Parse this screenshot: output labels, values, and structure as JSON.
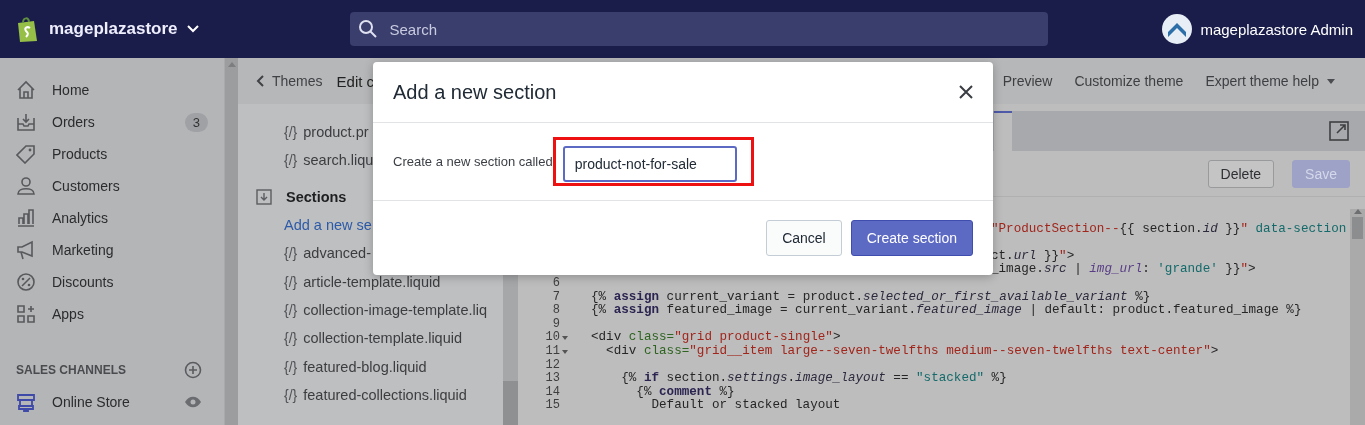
{
  "top_bar": {
    "store_name": "mageplazastore",
    "search": {
      "placeholder": "Search"
    },
    "account_name": "mageplazastore Admin"
  },
  "sidebar": {
    "items": [
      {
        "label": "Home"
      },
      {
        "label": "Orders",
        "badge": "3"
      },
      {
        "label": "Products"
      },
      {
        "label": "Customers"
      },
      {
        "label": "Analytics"
      },
      {
        "label": "Marketing"
      },
      {
        "label": "Discounts"
      },
      {
        "label": "Apps"
      }
    ],
    "sales_channels": {
      "heading": "SALES CHANNELS",
      "items": [
        {
          "label": "Online Store"
        }
      ]
    }
  },
  "header": {
    "back_link": "Themes",
    "title": "Edit c",
    "actions": [
      {
        "label": "Preview",
        "dropdown": false
      },
      {
        "label": "Customize theme",
        "dropdown": false
      },
      {
        "label": "Expert theme help",
        "dropdown": true
      }
    ]
  },
  "file_list": {
    "items": [
      {
        "kind": "file",
        "glyph": "{/}",
        "label": "product.pr"
      },
      {
        "kind": "file",
        "glyph": "{/}",
        "label": "search.liqu"
      },
      {
        "kind": "folder",
        "label": "Sections"
      },
      {
        "kind": "link",
        "label": "Add a new se"
      },
      {
        "kind": "file",
        "glyph": "{/}",
        "label": "advanced-"
      },
      {
        "kind": "file",
        "glyph": "{/}",
        "label": "article-template.liquid"
      },
      {
        "kind": "file",
        "glyph": "{/}",
        "label": "collection-image-template.liq"
      },
      {
        "kind": "file",
        "glyph": "{/}",
        "label": "collection-template.liquid"
      },
      {
        "kind": "file",
        "glyph": "{/}",
        "label": "featured-blog.liquid"
      },
      {
        "kind": "file",
        "glyph": "{/}",
        "label": "featured-collections.liquid"
      }
    ]
  },
  "editor": {
    "buttons": [
      {
        "label": "Delete",
        "disabled": false
      },
      {
        "label": "Save",
        "disabled": true
      }
    ],
    "lines": [
      {
        "kind": "hidden"
      },
      {
        "kind": "fragment",
        "tokens": [
          {
            "t": "\"ProductSection--",
            "kind": "str"
          },
          {
            "t": "{{ section.",
            "kind": "p"
          },
          {
            "t": "id",
            "kind": "i"
          },
          {
            "t": " }}",
            "kind": "p"
          },
          {
            "t": "\"",
            "kind": "str"
          },
          {
            "t": " data-section",
            "kind": "teal"
          }
        ]
      },
      {
        "kind": "hidden"
      },
      {
        "kind": "fragment",
        "tokens": [
          {
            "t": "ct.",
            "kind": "p"
          },
          {
            "t": "url",
            "kind": "i"
          },
          {
            "t": " }}",
            "kind": "p"
          },
          {
            "t": "\"",
            "kind": "str"
          },
          {
            "t": ">",
            "kind": "p"
          }
        ]
      },
      {
        "kind": "fragment",
        "tokens": [
          {
            "t": "_image.",
            "kind": "p"
          },
          {
            "t": "src",
            "kind": "i"
          },
          {
            "t": " | ",
            "kind": "p"
          },
          {
            "t": "img_url",
            "kind": "fn"
          },
          {
            "t": ": ",
            "kind": "p"
          },
          {
            "t": "'grande'",
            "kind": "teal"
          },
          {
            "t": " }}",
            "kind": "p"
          },
          {
            "t": "\"",
            "kind": "str"
          },
          {
            "t": ">",
            "kind": "p"
          }
        ]
      },
      {
        "kind": "line",
        "number": "6",
        "fold": false
      },
      {
        "kind": "line",
        "number": "7",
        "fold": false,
        "tokens": [
          {
            "t": "{% ",
            "kind": "p"
          },
          {
            "t": "assign",
            "kind": "kw"
          },
          {
            "t": " current_variant = product.",
            "kind": "p"
          },
          {
            "t": "selected_or_first_available_variant",
            "kind": "i"
          },
          {
            "t": " %}",
            "kind": "p"
          }
        ]
      },
      {
        "kind": "line",
        "number": "8",
        "fold": false,
        "tokens": [
          {
            "t": "{% ",
            "kind": "p"
          },
          {
            "t": "assign",
            "kind": "kw"
          },
          {
            "t": " featured_image = current_variant.",
            "kind": "p"
          },
          {
            "t": "featured_image",
            "kind": "i"
          },
          {
            "t": " | default: product.featured_image %}",
            "kind": "p"
          }
        ]
      },
      {
        "kind": "line",
        "number": "9",
        "fold": false
      },
      {
        "kind": "line",
        "number": "10",
        "fold": true,
        "tokens": [
          {
            "t": "<div ",
            "kind": "p"
          },
          {
            "t": "class=",
            "kind": "attr"
          },
          {
            "t": "\"grid product-single\"",
            "kind": "str"
          },
          {
            "t": ">",
            "kind": "p"
          }
        ]
      },
      {
        "kind": "line",
        "number": "11",
        "fold": true,
        "tokens": [
          {
            "t": "  <div ",
            "kind": "p"
          },
          {
            "t": "class=",
            "kind": "attr"
          },
          {
            "t": "\"grid__item large--seven-twelfths medium--seven-twelfths text-center\"",
            "kind": "str"
          },
          {
            "t": ">",
            "kind": "p"
          }
        ]
      },
      {
        "kind": "line",
        "number": "12",
        "fold": false
      },
      {
        "kind": "line",
        "number": "13",
        "fold": false,
        "tokens": [
          {
            "t": "    {% ",
            "kind": "p"
          },
          {
            "t": "if",
            "kind": "kw"
          },
          {
            "t": " section.",
            "kind": "p"
          },
          {
            "t": "settings",
            "kind": "i"
          },
          {
            "t": ".",
            "kind": "p"
          },
          {
            "t": "image_layout",
            "kind": "i"
          },
          {
            "t": " == ",
            "kind": "p"
          },
          {
            "t": "\"stacked\"",
            "kind": "teal"
          },
          {
            "t": " %}",
            "kind": "p"
          }
        ]
      },
      {
        "kind": "line",
        "number": "14",
        "fold": false,
        "tokens": [
          {
            "t": "      {% ",
            "kind": "p"
          },
          {
            "t": "comment",
            "kind": "kw"
          },
          {
            "t": " %}",
            "kind": "p"
          }
        ]
      },
      {
        "kind": "line",
        "number": "15",
        "fold": false,
        "tokens": [
          {
            "t": "        Default or stacked layout",
            "kind": "p"
          }
        ]
      }
    ]
  },
  "modal": {
    "title": "Add a new section",
    "field_label": "Create a new section called",
    "field_value": "product-not-for-sale",
    "highlighted": true,
    "buttons": [
      {
        "label": "Cancel",
        "kind": "secondary"
      },
      {
        "label": "Create section",
        "kind": "primary"
      }
    ]
  }
}
